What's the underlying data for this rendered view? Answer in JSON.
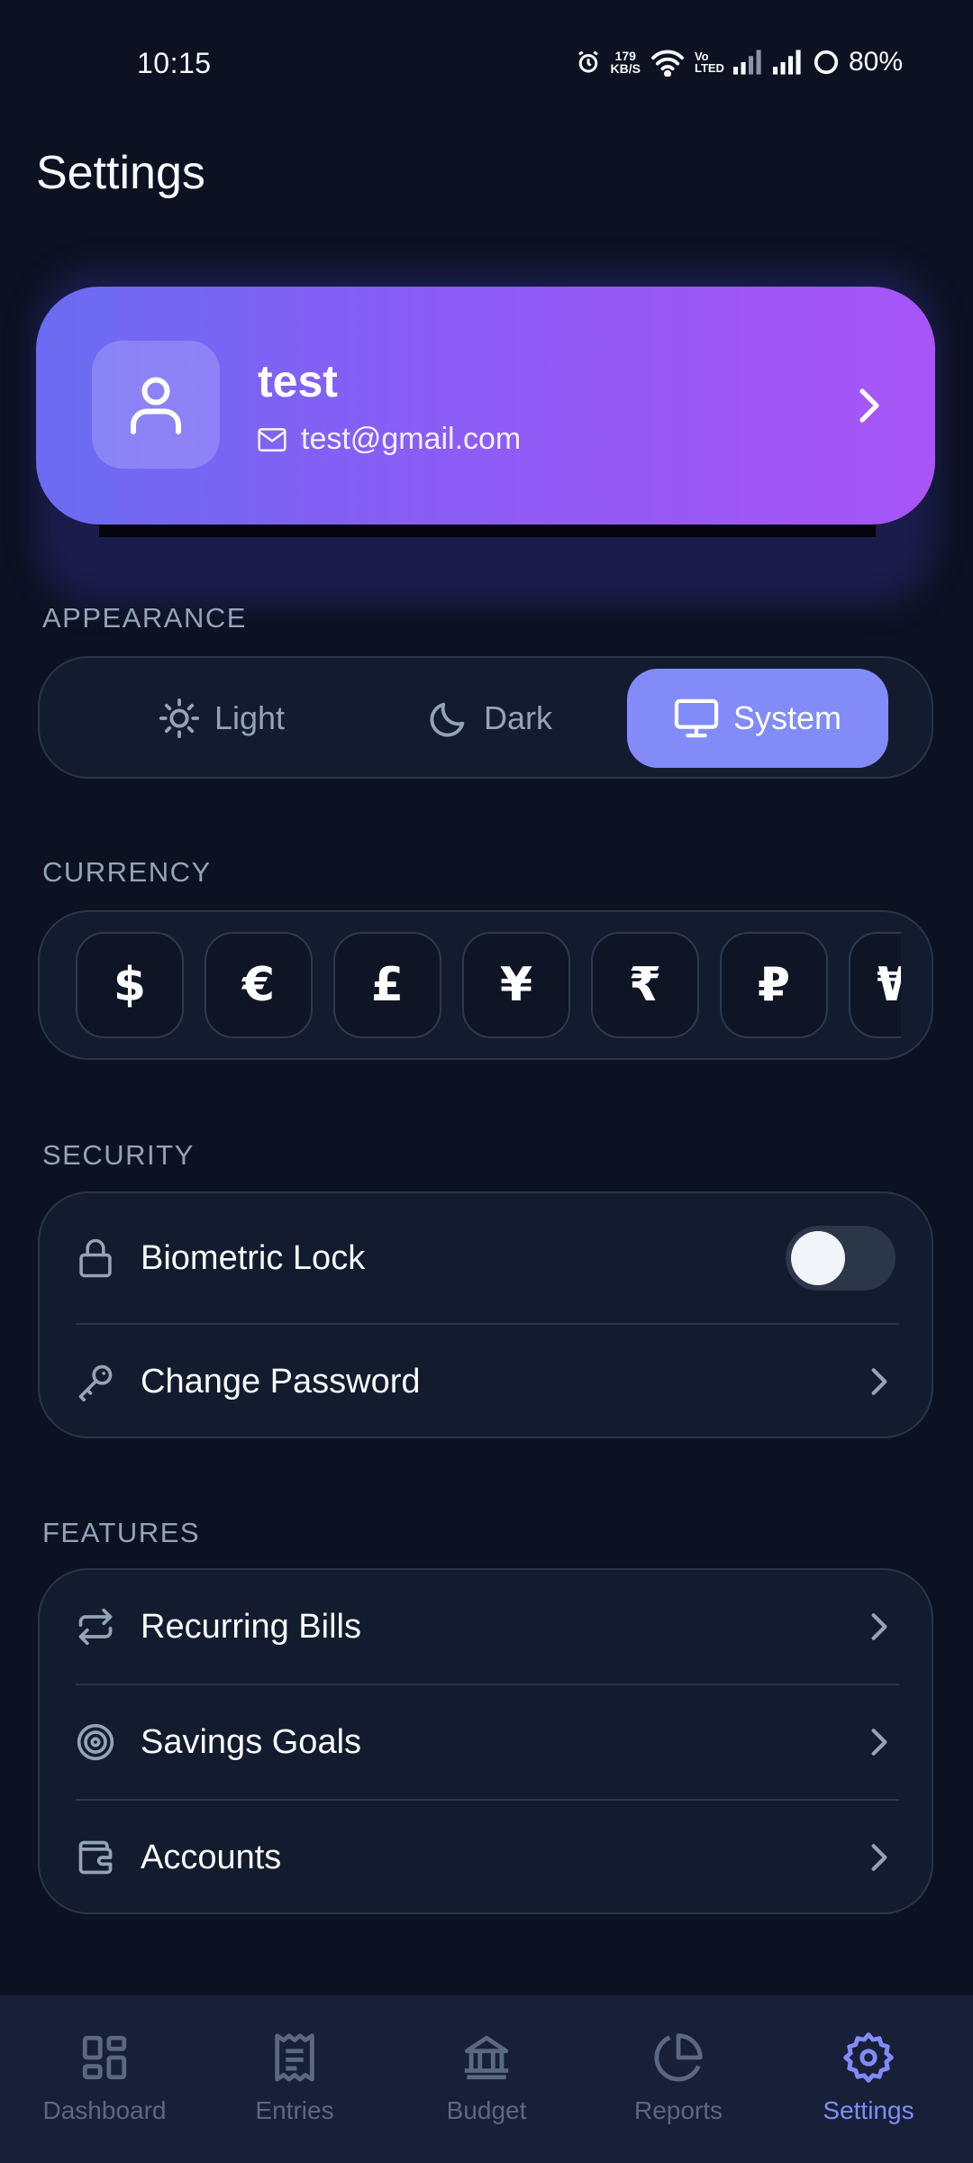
{
  "status_bar": {
    "time": "10:15",
    "speed_value": "179",
    "speed_unit": "KB/S",
    "volte_top": "Vo",
    "volte_bottom": "LTED",
    "battery": "80%"
  },
  "page": {
    "title": "Settings"
  },
  "profile": {
    "name": "test",
    "email": "test@gmail.com"
  },
  "appearance": {
    "section_label": "APPEARANCE",
    "options": [
      {
        "label": "Light",
        "icon": "sun-icon"
      },
      {
        "label": "Dark",
        "icon": "moon-icon"
      },
      {
        "label": "System",
        "icon": "monitor-icon"
      }
    ],
    "selected": "System"
  },
  "currency": {
    "section_label": "CURRENCY",
    "symbols": [
      "$",
      "€",
      "£",
      "¥",
      "₹",
      "₽",
      "₩"
    ]
  },
  "security": {
    "section_label": "SECURITY",
    "biometric_label": "Biometric Lock",
    "biometric_enabled": false,
    "change_password_label": "Change Password"
  },
  "features": {
    "section_label": "FEATURES",
    "items": [
      {
        "label": "Recurring Bills",
        "icon": "repeat-icon"
      },
      {
        "label": "Savings Goals",
        "icon": "target-icon"
      },
      {
        "label": "Accounts",
        "icon": "wallet-icon"
      }
    ]
  },
  "bottom_nav": {
    "items": [
      {
        "label": "Dashboard",
        "icon": "dashboard-icon"
      },
      {
        "label": "Entries",
        "icon": "receipt-icon"
      },
      {
        "label": "Budget",
        "icon": "bank-icon"
      },
      {
        "label": "Reports",
        "icon": "pie-chart-icon"
      },
      {
        "label": "Settings",
        "icon": "gear-icon"
      }
    ],
    "active": "Settings"
  },
  "colors": {
    "background": "#0c1222",
    "card": "#131c2e",
    "accent": "#818cf8",
    "gradient_start": "#6a6cf2",
    "gradient_end": "#a855f7"
  }
}
